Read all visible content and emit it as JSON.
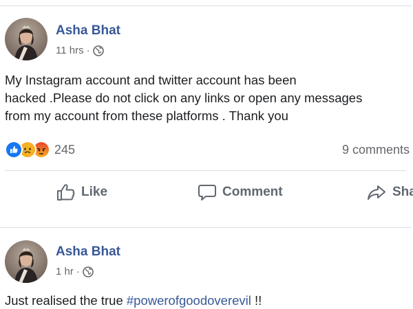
{
  "posts": [
    {
      "author": "Asha Bhat",
      "time": "11 hrs",
      "separator": "·",
      "privacy_icon": "globe-icon",
      "text_lines": [
        "My Instagram account and twitter account has been",
        "hacked .Please do not click on any links or open any messages",
        "from my account from these platforms . Thank you"
      ],
      "reactions": {
        "icons": [
          "like-icon",
          "sad-icon",
          "angry-icon"
        ],
        "count": "245"
      },
      "comments": "9 comments",
      "actions": {
        "like": "Like",
        "comment": "Comment",
        "share": "Share"
      }
    },
    {
      "author": "Asha Bhat",
      "time": "1 hr",
      "separator": "·",
      "privacy_icon": "globe-icon",
      "text_prefix": "Just realised the true ",
      "hashtag": "#powerofgoodoverevil",
      "text_suffix": " !!"
    }
  ],
  "colors": {
    "author_link": "#385898",
    "secondary_text": "#65676b",
    "like_blue": "#1877f2",
    "divider": "#dadde1"
  }
}
